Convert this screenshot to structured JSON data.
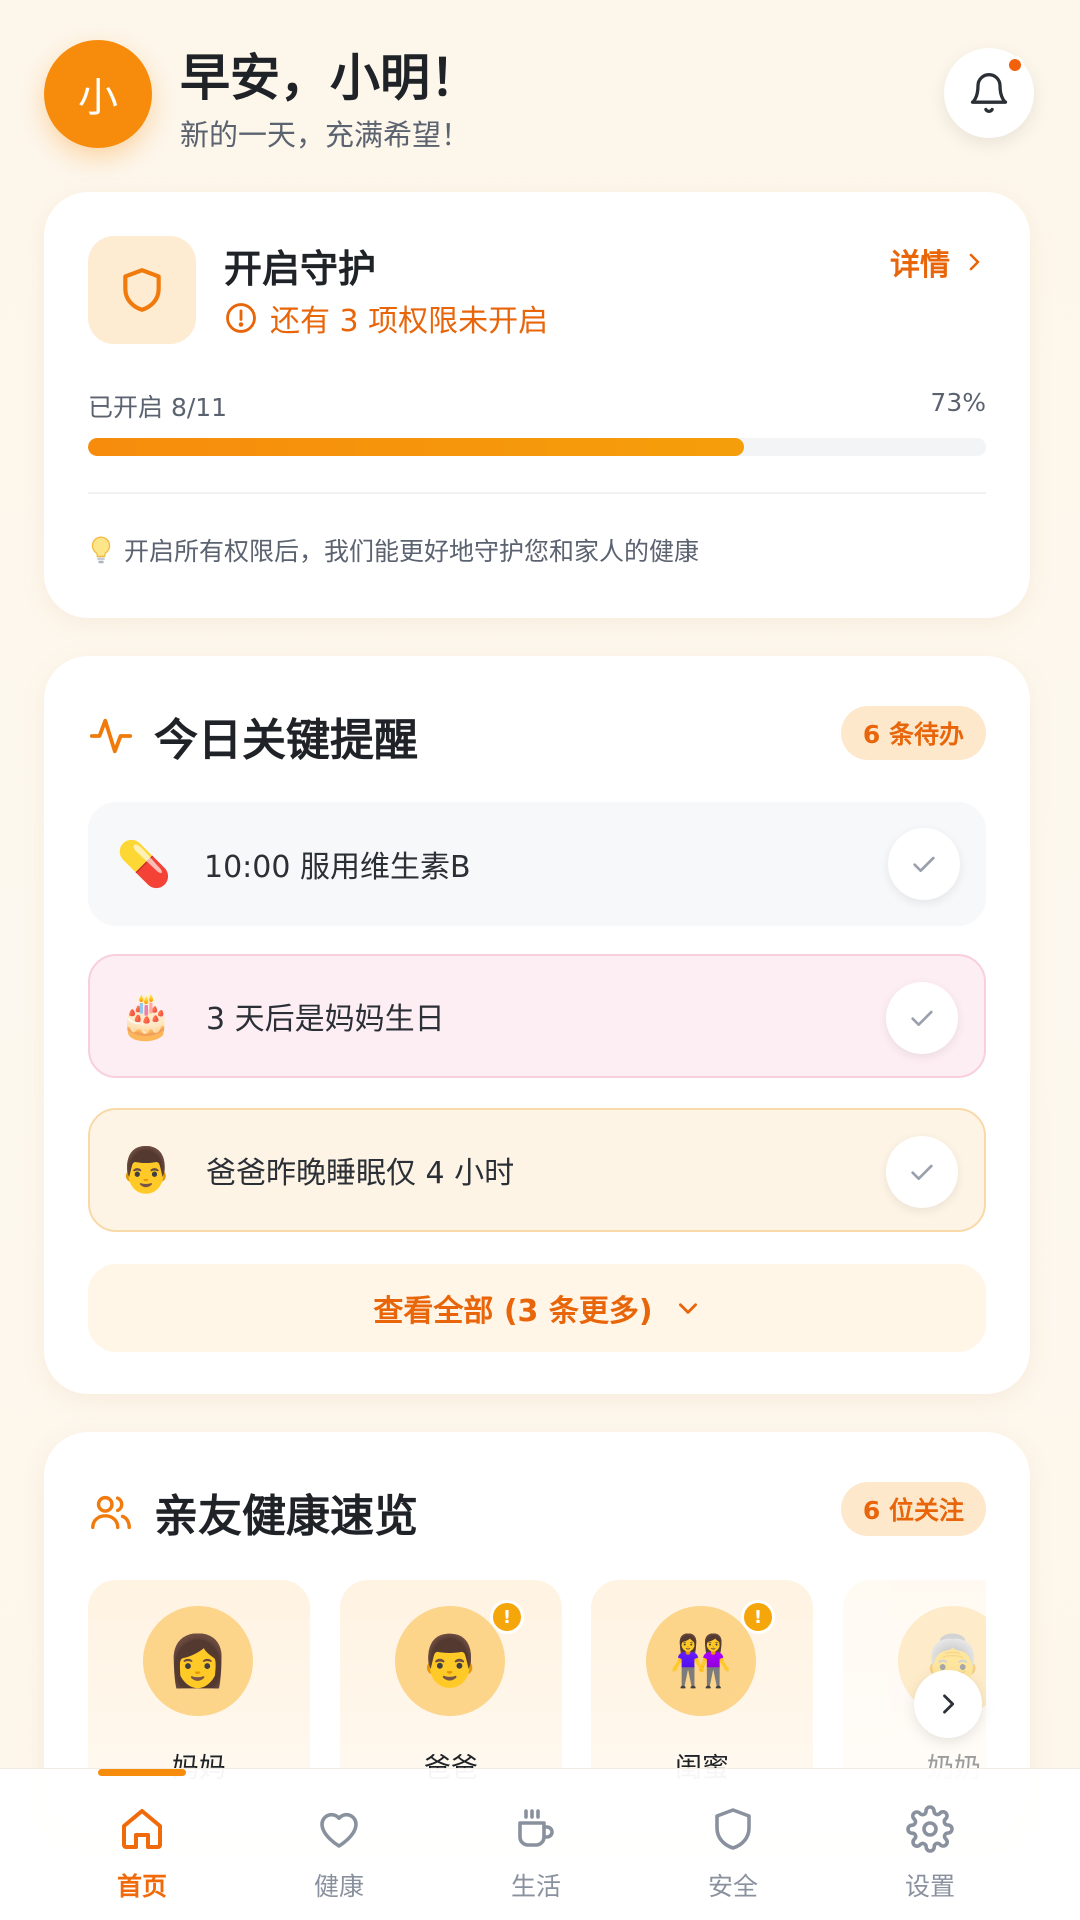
{
  "header": {
    "avatar_char": "小",
    "greeting": "早安，小明！",
    "subtitle": "新的一天，充满希望！",
    "has_notification": true
  },
  "guard": {
    "title": "开启守护",
    "warning": "还有 3 项权限未开启",
    "details_label": "详情",
    "progress_label": "已开启 8/11",
    "progress_percent_label": "73%",
    "progress_fraction": 0.73,
    "tip": "开启所有权限后，我们能更好地守护您和家人的健康"
  },
  "reminders": {
    "title": "今日关键提醒",
    "badge": "6 条待办",
    "items": [
      {
        "emoji": "💊",
        "text": "10:00 服用维生素B"
      },
      {
        "emoji": "🎂",
        "text": "3 天后是妈妈生日"
      },
      {
        "emoji": "👨",
        "text": "爸爸昨晚睡眠仅 4 小时"
      }
    ],
    "view_all": "查看全部 (3 条更多)"
  },
  "friends": {
    "title": "亲友健康速览",
    "badge": "6 位关注",
    "people": [
      {
        "emoji": "👩",
        "name": "妈妈",
        "alert": false
      },
      {
        "emoji": "👨",
        "name": "爸爸",
        "alert": true
      },
      {
        "emoji": "👭",
        "name": "闺蜜",
        "alert": true
      },
      {
        "emoji": "👵",
        "name": "奶奶",
        "alert": false
      }
    ],
    "alert_mark": "!"
  },
  "nav": {
    "items": [
      {
        "label": "首页",
        "icon": "home-icon",
        "active": true
      },
      {
        "label": "健康",
        "icon": "heart-icon",
        "active": false
      },
      {
        "label": "生活",
        "icon": "cup-icon",
        "active": false
      },
      {
        "label": "安全",
        "icon": "shield-icon",
        "active": false
      },
      {
        "label": "设置",
        "icon": "gear-icon",
        "active": false
      }
    ]
  },
  "colors": {
    "accent": "#f78c0c",
    "accent_text": "#e8650a",
    "background": "#fdf6ea"
  }
}
